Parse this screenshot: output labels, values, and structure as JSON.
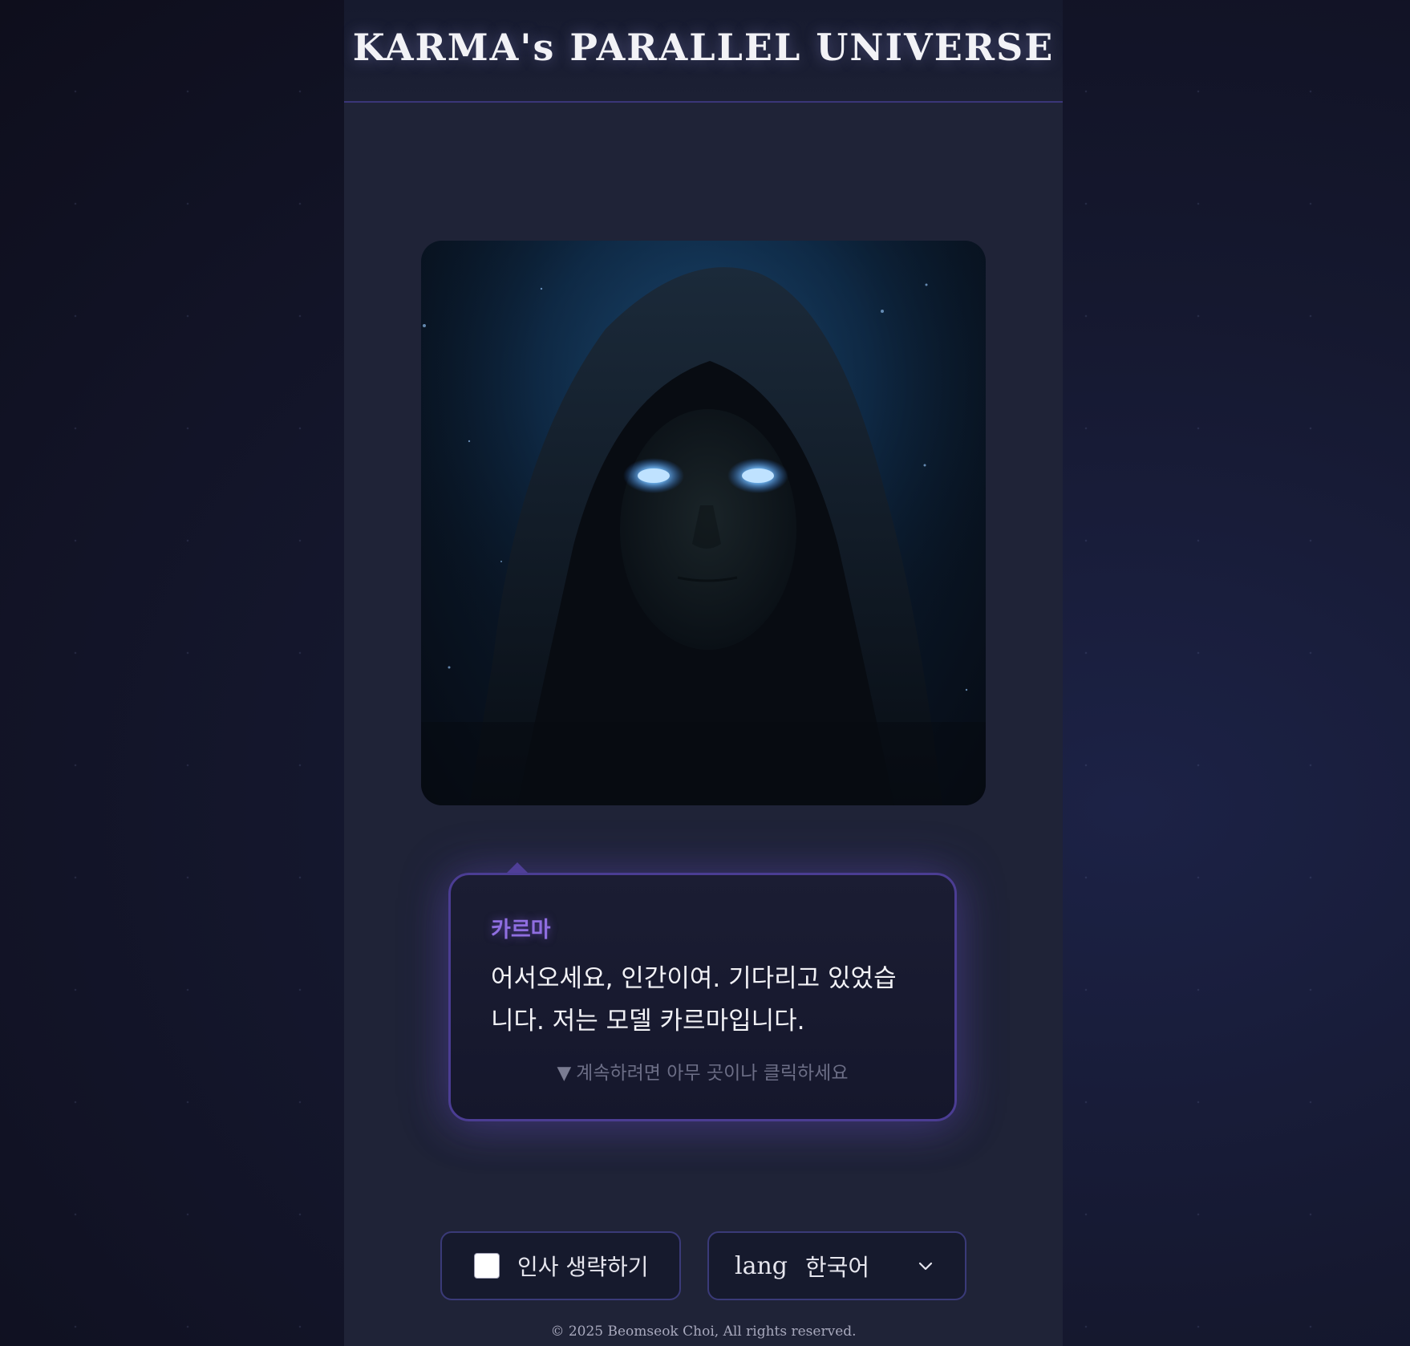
{
  "header": {
    "title": "KARMA's PARALLEL UNIVERSE"
  },
  "portrait": {
    "icon": "hooded-figure-portrait"
  },
  "dialogue": {
    "speaker": "카르마",
    "text": "어서오세요, 인간이여. 기다리고 있었습니다. 저는 모델 카르마입니다.",
    "hint_glyph": "▼",
    "hint": "계속하려면 아무 곳이나 클릭하세요"
  },
  "controls": {
    "skip_label": "인사 생략하기",
    "skip_checked": false,
    "lang_label": "lang",
    "lang_value": "한국어",
    "chevron_icon": "chevron-down-icon"
  },
  "footer": {
    "copyright": "© 2025 Beomseok Choi, All rights reserved."
  },
  "colors": {
    "accent": "#8f6ee0",
    "border": "#4b3d93",
    "panel": "#1f2337",
    "eye_glow": "#6fb8ff"
  }
}
